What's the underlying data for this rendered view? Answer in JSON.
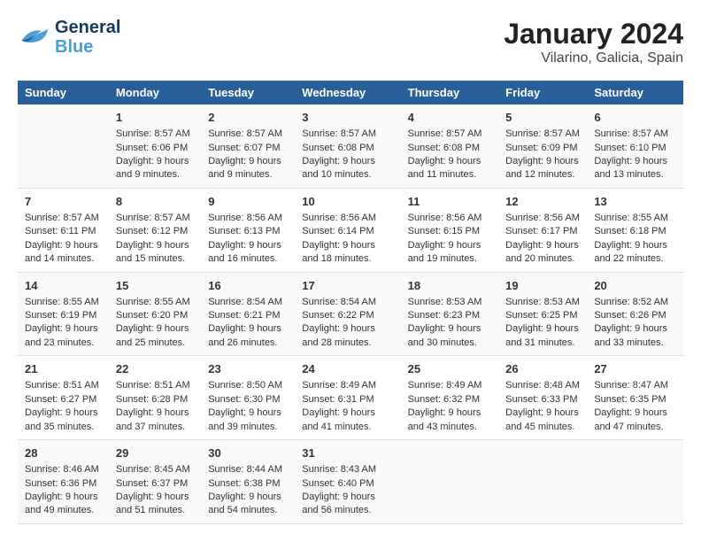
{
  "logo": {
    "general": "General",
    "blue": "Blue"
  },
  "title": "January 2024",
  "subtitle": "Vilarino, Galicia, Spain",
  "days_of_week": [
    "Sunday",
    "Monday",
    "Tuesday",
    "Wednesday",
    "Thursday",
    "Friday",
    "Saturday"
  ],
  "weeks": [
    [
      {
        "day": "",
        "sunrise": "",
        "sunset": "",
        "daylight": ""
      },
      {
        "day": "1",
        "sunrise": "Sunrise: 8:57 AM",
        "sunset": "Sunset: 6:06 PM",
        "daylight": "Daylight: 9 hours and 9 minutes."
      },
      {
        "day": "2",
        "sunrise": "Sunrise: 8:57 AM",
        "sunset": "Sunset: 6:07 PM",
        "daylight": "Daylight: 9 hours and 9 minutes."
      },
      {
        "day": "3",
        "sunrise": "Sunrise: 8:57 AM",
        "sunset": "Sunset: 6:08 PM",
        "daylight": "Daylight: 9 hours and 10 minutes."
      },
      {
        "day": "4",
        "sunrise": "Sunrise: 8:57 AM",
        "sunset": "Sunset: 6:08 PM",
        "daylight": "Daylight: 9 hours and 11 minutes."
      },
      {
        "day": "5",
        "sunrise": "Sunrise: 8:57 AM",
        "sunset": "Sunset: 6:09 PM",
        "daylight": "Daylight: 9 hours and 12 minutes."
      },
      {
        "day": "6",
        "sunrise": "Sunrise: 8:57 AM",
        "sunset": "Sunset: 6:10 PM",
        "daylight": "Daylight: 9 hours and 13 minutes."
      }
    ],
    [
      {
        "day": "7",
        "sunrise": "Sunrise: 8:57 AM",
        "sunset": "Sunset: 6:11 PM",
        "daylight": "Daylight: 9 hours and 14 minutes."
      },
      {
        "day": "8",
        "sunrise": "Sunrise: 8:57 AM",
        "sunset": "Sunset: 6:12 PM",
        "daylight": "Daylight: 9 hours and 15 minutes."
      },
      {
        "day": "9",
        "sunrise": "Sunrise: 8:56 AM",
        "sunset": "Sunset: 6:13 PM",
        "daylight": "Daylight: 9 hours and 16 minutes."
      },
      {
        "day": "10",
        "sunrise": "Sunrise: 8:56 AM",
        "sunset": "Sunset: 6:14 PM",
        "daylight": "Daylight: 9 hours and 18 minutes."
      },
      {
        "day": "11",
        "sunrise": "Sunrise: 8:56 AM",
        "sunset": "Sunset: 6:15 PM",
        "daylight": "Daylight: 9 hours and 19 minutes."
      },
      {
        "day": "12",
        "sunrise": "Sunrise: 8:56 AM",
        "sunset": "Sunset: 6:17 PM",
        "daylight": "Daylight: 9 hours and 20 minutes."
      },
      {
        "day": "13",
        "sunrise": "Sunrise: 8:55 AM",
        "sunset": "Sunset: 6:18 PM",
        "daylight": "Daylight: 9 hours and 22 minutes."
      }
    ],
    [
      {
        "day": "14",
        "sunrise": "Sunrise: 8:55 AM",
        "sunset": "Sunset: 6:19 PM",
        "daylight": "Daylight: 9 hours and 23 minutes."
      },
      {
        "day": "15",
        "sunrise": "Sunrise: 8:55 AM",
        "sunset": "Sunset: 6:20 PM",
        "daylight": "Daylight: 9 hours and 25 minutes."
      },
      {
        "day": "16",
        "sunrise": "Sunrise: 8:54 AM",
        "sunset": "Sunset: 6:21 PM",
        "daylight": "Daylight: 9 hours and 26 minutes."
      },
      {
        "day": "17",
        "sunrise": "Sunrise: 8:54 AM",
        "sunset": "Sunset: 6:22 PM",
        "daylight": "Daylight: 9 hours and 28 minutes."
      },
      {
        "day": "18",
        "sunrise": "Sunrise: 8:53 AM",
        "sunset": "Sunset: 6:23 PM",
        "daylight": "Daylight: 9 hours and 30 minutes."
      },
      {
        "day": "19",
        "sunrise": "Sunrise: 8:53 AM",
        "sunset": "Sunset: 6:25 PM",
        "daylight": "Daylight: 9 hours and 31 minutes."
      },
      {
        "day": "20",
        "sunrise": "Sunrise: 8:52 AM",
        "sunset": "Sunset: 6:26 PM",
        "daylight": "Daylight: 9 hours and 33 minutes."
      }
    ],
    [
      {
        "day": "21",
        "sunrise": "Sunrise: 8:51 AM",
        "sunset": "Sunset: 6:27 PM",
        "daylight": "Daylight: 9 hours and 35 minutes."
      },
      {
        "day": "22",
        "sunrise": "Sunrise: 8:51 AM",
        "sunset": "Sunset: 6:28 PM",
        "daylight": "Daylight: 9 hours and 37 minutes."
      },
      {
        "day": "23",
        "sunrise": "Sunrise: 8:50 AM",
        "sunset": "Sunset: 6:30 PM",
        "daylight": "Daylight: 9 hours and 39 minutes."
      },
      {
        "day": "24",
        "sunrise": "Sunrise: 8:49 AM",
        "sunset": "Sunset: 6:31 PM",
        "daylight": "Daylight: 9 hours and 41 minutes."
      },
      {
        "day": "25",
        "sunrise": "Sunrise: 8:49 AM",
        "sunset": "Sunset: 6:32 PM",
        "daylight": "Daylight: 9 hours and 43 minutes."
      },
      {
        "day": "26",
        "sunrise": "Sunrise: 8:48 AM",
        "sunset": "Sunset: 6:33 PM",
        "daylight": "Daylight: 9 hours and 45 minutes."
      },
      {
        "day": "27",
        "sunrise": "Sunrise: 8:47 AM",
        "sunset": "Sunset: 6:35 PM",
        "daylight": "Daylight: 9 hours and 47 minutes."
      }
    ],
    [
      {
        "day": "28",
        "sunrise": "Sunrise: 8:46 AM",
        "sunset": "Sunset: 6:36 PM",
        "daylight": "Daylight: 9 hours and 49 minutes."
      },
      {
        "day": "29",
        "sunrise": "Sunrise: 8:45 AM",
        "sunset": "Sunset: 6:37 PM",
        "daylight": "Daylight: 9 hours and 51 minutes."
      },
      {
        "day": "30",
        "sunrise": "Sunrise: 8:44 AM",
        "sunset": "Sunset: 6:38 PM",
        "daylight": "Daylight: 9 hours and 54 minutes."
      },
      {
        "day": "31",
        "sunrise": "Sunrise: 8:43 AM",
        "sunset": "Sunset: 6:40 PM",
        "daylight": "Daylight: 9 hours and 56 minutes."
      },
      {
        "day": "",
        "sunrise": "",
        "sunset": "",
        "daylight": ""
      },
      {
        "day": "",
        "sunrise": "",
        "sunset": "",
        "daylight": ""
      },
      {
        "day": "",
        "sunrise": "",
        "sunset": "",
        "daylight": ""
      }
    ]
  ]
}
